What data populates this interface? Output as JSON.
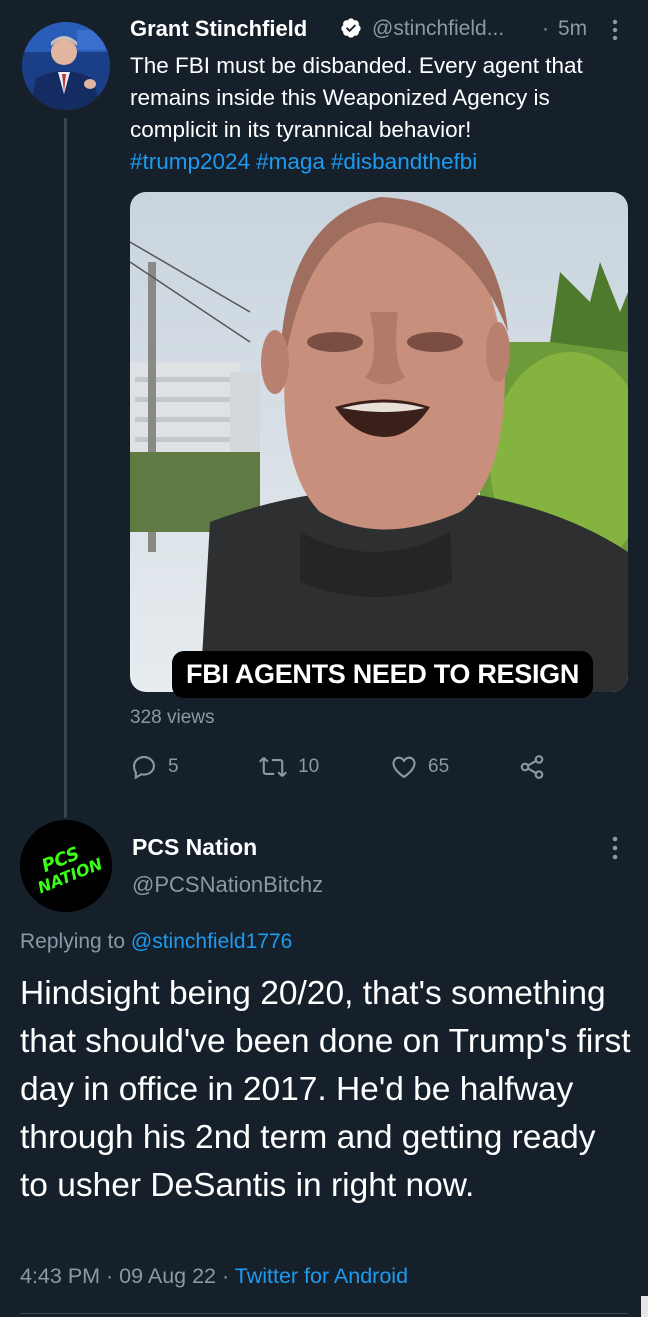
{
  "tweet1": {
    "author_name": "Grant Stinchfield",
    "handle": "@stinchfield...",
    "separator": "·",
    "time": "5m",
    "text": "The FBI must be disbanded. Every agent that remains inside this Weaponized Agency is complicit in its tyrannical behavior!",
    "hashtags": [
      "#trump2024",
      "#maga",
      "#disbandthefbi"
    ],
    "video_caption": "FBI AGENTS NEED TO RESIGN",
    "views": "328 views",
    "stats": {
      "replies": "5",
      "retweets": "10",
      "likes": "65"
    }
  },
  "tweet2": {
    "author_name": "PCS Nation",
    "handle": "@PCSNationBitchz",
    "avatar_logo_text": "PCS NATION",
    "replying_prefix": "Replying to",
    "replying_handle": "@stinchfield1776",
    "text": "Hindsight being 20/20, that's something that should've been done on Trump's first day in office in 2017. He'd be halfway through his 2nd term and getting ready to usher DeSantis in right now.",
    "timestamp": "4:43 PM · 09 Aug 22 · ",
    "source": "Twitter for Android"
  },
  "colors": {
    "background": "#15202b",
    "secondary_text": "#8b98a5",
    "link": "#1d9bf0",
    "divider": "#38444d",
    "logo_green": "#39ff14"
  },
  "icons": [
    "verified-badge-icon",
    "more-icon",
    "reply-icon",
    "retweet-icon",
    "like-icon",
    "share-icon"
  ]
}
